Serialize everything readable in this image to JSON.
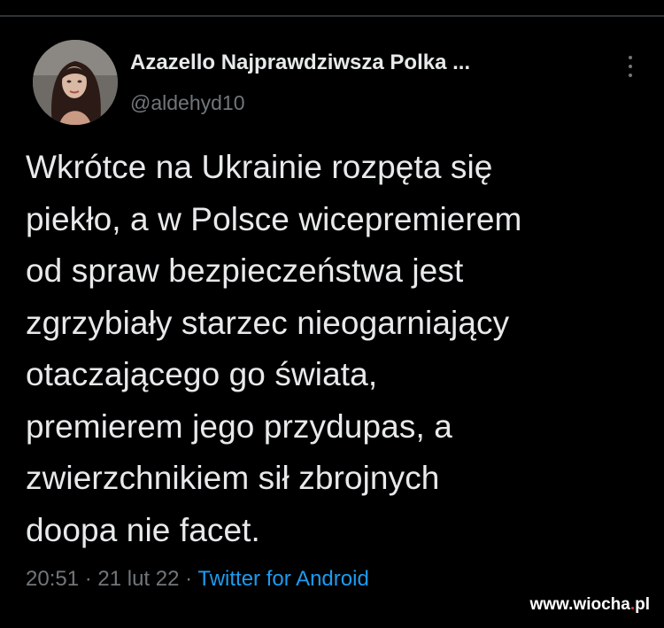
{
  "tweet": {
    "display_name": "Azazello Najprawdziwsza Polka ...",
    "handle": "@aldehyd10",
    "text_lines": [
      "Wkrótce na Ukrainie rozpęta się",
      "piekło, a w Polsce wicepremierem",
      "od spraw bezpieczeństwa jest",
      "zgrzybiały starzec nieogarniający",
      "otaczającego go świata,",
      "premierem jego przydupas, a",
      "zwierzchnikiem sił zbrojnych",
      "doopa nie facet."
    ],
    "time": "20:51",
    "separator": " · ",
    "date": "21 lut 22",
    "source": "Twitter for Android"
  },
  "watermark": {
    "prefix": "www.wiocha",
    "dot": ".",
    "suffix": "pl"
  },
  "icons": {
    "more": "more-vertical-icon",
    "avatar": "profile-photo"
  },
  "colors": {
    "background": "#000000",
    "text_primary": "#e7e9ea",
    "text_secondary": "#71767b",
    "link": "#1d9bf0",
    "watermark_dot": "#e03131"
  }
}
